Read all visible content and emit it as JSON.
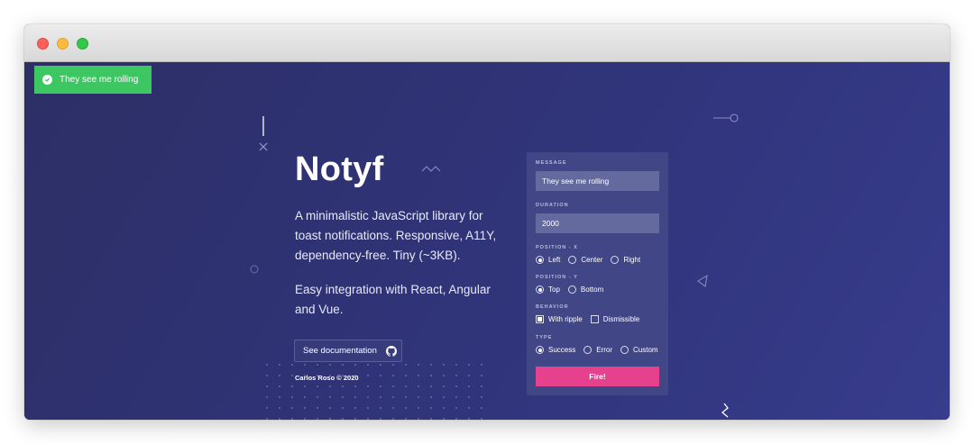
{
  "toast": {
    "text": "They see me rolling",
    "color": "#3dc763"
  },
  "hero": {
    "title": "Notyf",
    "description": "A minimalistic JavaScript library for toast notifications. Responsive, A11Y, dependency-free. Tiny (~3KB).",
    "integration": "Easy integration with React, Angular and Vue.",
    "docs_button": "See documentation",
    "footer": "Carlos Roso © 2020"
  },
  "form": {
    "message_label": "MESSAGE",
    "message_value": "They see me rolling",
    "duration_label": "DURATION",
    "duration_value": "2000",
    "position_x_label": "POSITION - X",
    "position_x_options": [
      "Left",
      "Center",
      "Right"
    ],
    "position_x_selected": "Left",
    "position_y_label": "POSITION - Y",
    "position_y_options": [
      "Top",
      "Bottom"
    ],
    "position_y_selected": "Top",
    "behavior_label": "BEHAVIOR",
    "behavior_options": [
      "With ripple",
      "Dismissible"
    ],
    "behavior_checked": [
      "With ripple"
    ],
    "type_label": "TYPE",
    "type_options": [
      "Success",
      "Error",
      "Custom"
    ],
    "type_selected": "Success",
    "fire_button": "Fire!",
    "accent_color": "#e6418c"
  },
  "icons": {
    "toast": "check-circle-icon",
    "docs": "github-icon"
  }
}
